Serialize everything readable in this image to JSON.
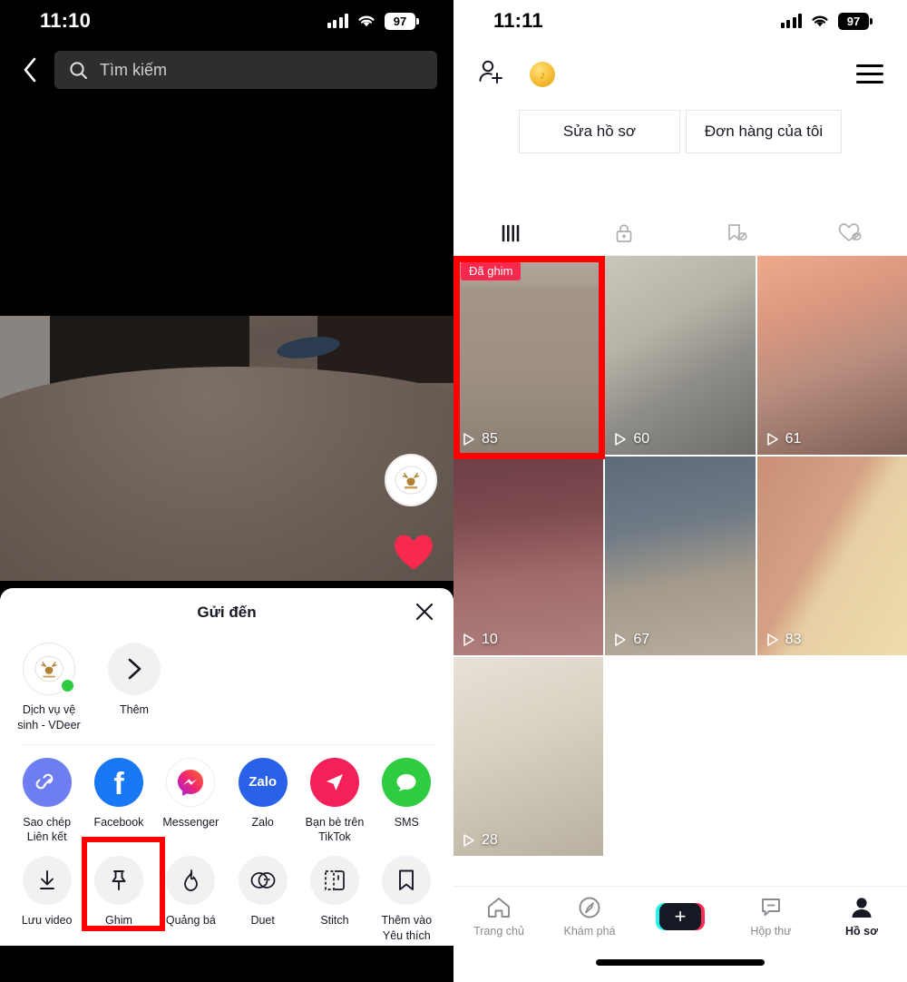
{
  "left_phone": {
    "status_bar": {
      "time": "11:10",
      "battery": "97",
      "signal_icon": "cellular-bars-icon",
      "wifi_icon": "wifi-icon"
    },
    "search": {
      "placeholder": "Tìm kiếm",
      "back_icon": "chevron-left-icon",
      "search_icon": "search-icon"
    },
    "video": {
      "avatar_icon": "deer-logo-avatar",
      "like_icon": "heart-icon"
    },
    "share_sheet": {
      "title": "Gửi đến",
      "close_icon": "close-icon",
      "friends": [
        {
          "label": "Dịch vụ vệ sinh - VDeer",
          "icon": "deer-logo-avatar",
          "online": true
        },
        {
          "label": "Thêm",
          "icon": "chevron-right-icon",
          "online": false
        }
      ],
      "apps": [
        {
          "label": "Sao chép Liên kết",
          "icon": "link-icon",
          "color": "#6e7ef0"
        },
        {
          "label": "Facebook",
          "icon": "facebook-icon",
          "color": "#1877f2"
        },
        {
          "label": "Messenger",
          "icon": "messenger-icon",
          "color": "#ffffff"
        },
        {
          "label": "Zalo",
          "icon": "zalo-icon",
          "color": "#2962e8"
        },
        {
          "label": "Bạn bè trên TikTok",
          "icon": "tiktok-friends-icon",
          "color": "#f4205a"
        },
        {
          "label": "SMS",
          "icon": "sms-icon",
          "color": "#2ecc40"
        }
      ],
      "actions": [
        {
          "label": "Lưu video",
          "icon": "download-icon",
          "highlighted": false
        },
        {
          "label": "Ghim",
          "icon": "pin-icon",
          "highlighted": true
        },
        {
          "label": "Quảng bá",
          "icon": "flame-icon",
          "highlighted": false
        },
        {
          "label": "Duet",
          "icon": "duet-icon",
          "highlighted": false
        },
        {
          "label": "Stitch",
          "icon": "stitch-icon",
          "highlighted": false
        },
        {
          "label": "Thêm vào Yêu thích",
          "icon": "bookmark-icon",
          "highlighted": false
        }
      ]
    }
  },
  "right_phone": {
    "status_bar": {
      "time": "11:11",
      "battery": "97",
      "signal_icon": "cellular-bars-icon",
      "wifi_icon": "wifi-icon"
    },
    "header": {
      "add_friend_icon": "add-person-icon",
      "coin_icon": "tiktok-coin-icon",
      "menu_icon": "hamburger-menu-icon"
    },
    "profile_buttons": [
      {
        "label": "Sửa hồ sơ"
      },
      {
        "label": "Đơn hàng của tôi"
      }
    ],
    "profile_tabs": [
      {
        "icon": "grid-posts-icon",
        "active": true
      },
      {
        "icon": "lock-private-icon",
        "active": false
      },
      {
        "icon": "repost-hidden-icon",
        "active": false
      },
      {
        "icon": "liked-hidden-icon",
        "active": false
      }
    ],
    "videos": [
      {
        "views": "85",
        "pinned": true,
        "pin_label": "Đã ghim",
        "highlighted": true
      },
      {
        "views": "60",
        "pinned": false,
        "pin_label": "",
        "highlighted": false
      },
      {
        "views": "61",
        "pinned": false,
        "pin_label": "",
        "highlighted": false
      },
      {
        "views": "10",
        "pinned": false,
        "pin_label": "",
        "highlighted": false
      },
      {
        "views": "67",
        "pinned": false,
        "pin_label": "",
        "highlighted": false
      },
      {
        "views": "83",
        "pinned": false,
        "pin_label": "",
        "highlighted": false
      },
      {
        "views": "28",
        "pinned": false,
        "pin_label": "",
        "highlighted": false
      }
    ],
    "bottom_nav": [
      {
        "label": "Trang chủ",
        "icon": "home-icon",
        "active": false
      },
      {
        "label": "Khám phá",
        "icon": "compass-icon",
        "active": false
      },
      {
        "label": "",
        "icon": "create-plus-icon",
        "active": false
      },
      {
        "label": "Hộp thư",
        "icon": "inbox-icon",
        "active": false
      },
      {
        "label": "Hồ sơ",
        "icon": "profile-person-icon",
        "active": true
      }
    ]
  },
  "colors": {
    "accent_red": "#ff0000",
    "tiktok_pink": "#fe2c55",
    "tiktok_cyan": "#25f4ee"
  }
}
